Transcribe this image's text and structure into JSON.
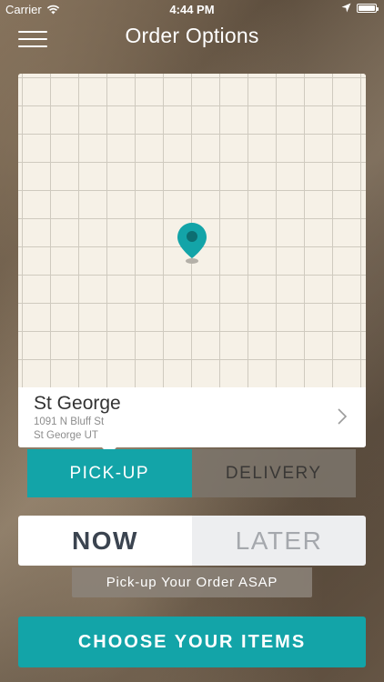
{
  "status_bar": {
    "carrier": "Carrier",
    "time": "4:44 PM"
  },
  "nav": {
    "title": "Order Options"
  },
  "location": {
    "name": "St George",
    "address_line1": "1091 N Bluff St",
    "address_line2": "St George UT"
  },
  "order_type": {
    "pickup_label": "PICK-UP",
    "delivery_label": "DELIVERY",
    "selected": "PICK-UP"
  },
  "timing": {
    "now_label": "NOW",
    "later_label": "LATER",
    "selected": "NOW",
    "hint": "Pick-up Your Order ASAP"
  },
  "cta": {
    "label": "CHOOSE YOUR ITEMS"
  },
  "colors": {
    "accent": "#13a4a8",
    "map_background": "#f6f1e7"
  },
  "icons": [
    "wifi-icon",
    "location-arrow-icon",
    "battery-icon",
    "menu-icon",
    "map-pin-icon",
    "chevron-right-icon"
  ]
}
